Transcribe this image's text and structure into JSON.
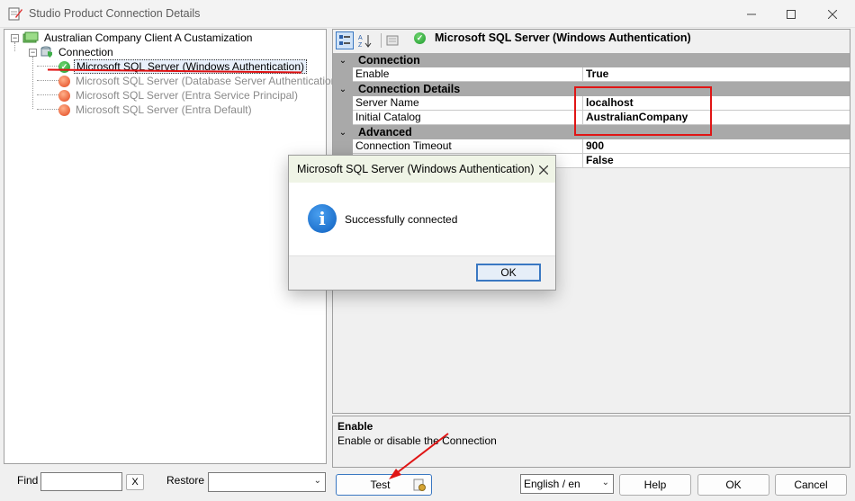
{
  "window": {
    "title": "Studio Product Connection Details"
  },
  "tree": {
    "root": "Australian Company Client A Custamization",
    "group": "Connection",
    "items": [
      {
        "label": "Microsoft SQL Server (Windows Authentication)",
        "status": "ok",
        "selected": true
      },
      {
        "label": "Microsoft SQL Server (Database Server Authentication)",
        "status": "error"
      },
      {
        "label": "Microsoft SQL Server (Entra Service Principal)",
        "status": "error"
      },
      {
        "label": "Microsoft SQL Server (Entra Default)",
        "status": "error"
      }
    ]
  },
  "grid": {
    "title": "Microsoft SQL Server (Windows Authentication)",
    "categories": [
      {
        "name": "Connection",
        "props": [
          {
            "name": "Enable",
            "value": "True"
          }
        ]
      },
      {
        "name": "Connection Details",
        "props": [
          {
            "name": "Server Name",
            "value": "localhost"
          },
          {
            "name": "Initial Catalog",
            "value": "AustralianCompany"
          }
        ]
      },
      {
        "name": "Advanced",
        "props": [
          {
            "name": "Connection Timeout",
            "value": "900"
          },
          {
            "name": "",
            "value": "False"
          }
        ]
      }
    ]
  },
  "description": {
    "title": "Enable",
    "text": "Enable or disable the Connection"
  },
  "bottom": {
    "find_label": "Find",
    "find_clear": "X",
    "restore_label": "Restore",
    "test_button": "Test",
    "language": "English / en",
    "help_button": "Help",
    "ok_button": "OK",
    "cancel_button": "Cancel"
  },
  "dialog": {
    "title": "Microsoft SQL Server (Windows Authentication)",
    "message": "Successfully connected",
    "ok_button": "OK"
  },
  "colors": {
    "annotation": "#e01515",
    "category_bg": "#a9a9a9",
    "dialog_header": "#eff4e6"
  }
}
